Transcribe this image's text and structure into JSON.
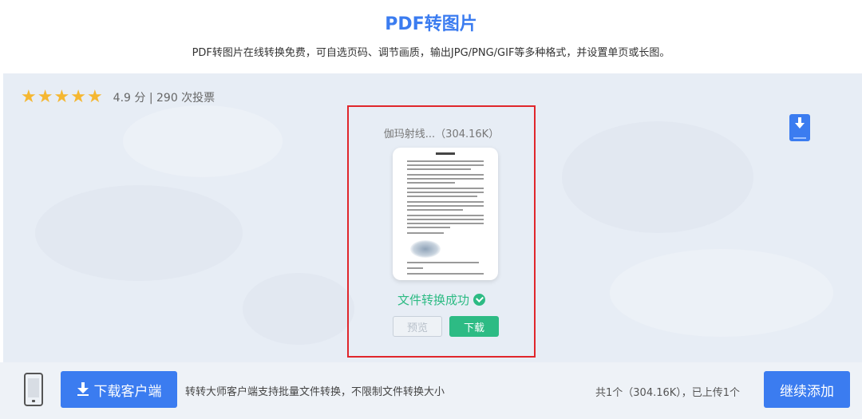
{
  "header": {
    "title": "PDF转图片",
    "subtitle": "PDF转图片在线转换免费，可自选页码、调节画质，输出JPG/PNG/GIF等多种格式，并设置单页或长图。"
  },
  "rating": {
    "stars": 5,
    "score": "4.9",
    "text": "4.9  分 | 290 次投票"
  },
  "file": {
    "name": "伽玛射线...（304.16K）",
    "status": "文件转换成功",
    "preview_label": "预览",
    "download_label": "下载"
  },
  "footer": {
    "client_button": "下载客户端",
    "client_desc": "转转大师客户端支持批量文件转换，不限制文件转换大小",
    "upload_status": "共1个（304.16K），已上传1个",
    "continue_button": "继续添加"
  },
  "colors": {
    "accent": "#3b7cf0",
    "success": "#2dbb84",
    "highlight": "#e0262b",
    "star": "#f5b731"
  },
  "icons": [
    "star-icon",
    "download-icon",
    "check-circle-icon",
    "phone-icon"
  ]
}
